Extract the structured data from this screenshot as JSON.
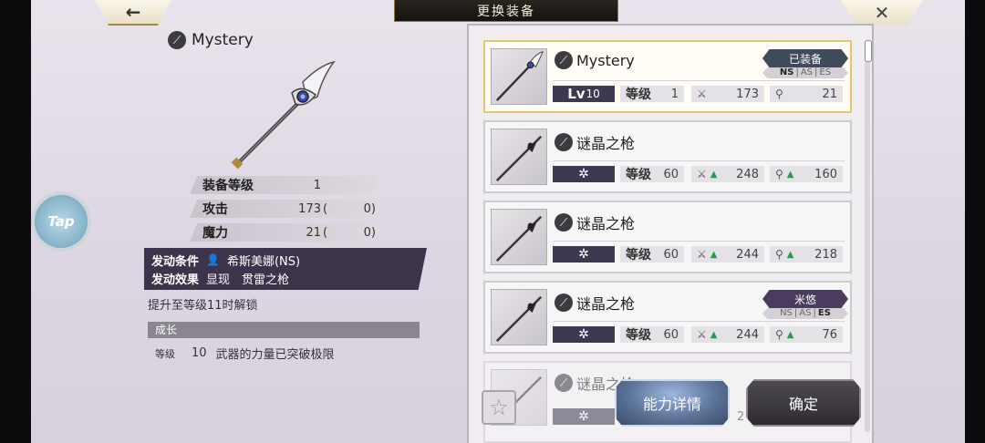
{
  "header": {
    "title": "更换装备",
    "back_icon": "←",
    "close_icon": "✕"
  },
  "detail": {
    "weapon_name": "Mystery",
    "stats": {
      "equip_level_label": "装备等级",
      "equip_level_value": "1",
      "attack_label": "攻击",
      "attack_value": "173",
      "attack_bonus": "0",
      "magic_label": "魔力",
      "magic_value": "21",
      "magic_bonus": "0",
      "paren_open": "(",
      "paren_close": ")"
    },
    "trigger": {
      "condition_label": "发动条件",
      "condition_value": "希斯美娜(NS)",
      "effect_label": "发动效果",
      "effect_value": "显现　贯雷之枪"
    },
    "unlock_text": "提升至等级11时解锁",
    "growth": {
      "title": "成长",
      "level_label": "等级",
      "level_value": "10",
      "description": "武器的力量已突破极限"
    }
  },
  "tap_label": "Tap",
  "list": [
    {
      "name": "Mystery",
      "lv_prefix": "Lv",
      "lv_value": "10",
      "level_label": "等级",
      "level_value": "1",
      "attack": "173",
      "magic": "21",
      "badge": "已装备",
      "badge_tags": [
        "NS",
        "AS",
        "ES"
      ]
    },
    {
      "name": "谜晶之枪",
      "gear": "✲",
      "level_label": "等级",
      "level_value": "60",
      "attack": "248",
      "magic": "160"
    },
    {
      "name": "谜晶之枪",
      "gear": "✲",
      "level_label": "等级",
      "level_value": "60",
      "attack": "244",
      "magic": "218"
    },
    {
      "name": "谜晶之枪",
      "gear": "✲",
      "level_label": "等级",
      "level_value": "60",
      "attack": "244",
      "magic": "76",
      "badge": "米悠",
      "badge_tags": [
        "NS",
        "AS",
        "ES"
      ]
    },
    {
      "name": "谜晶之枪",
      "gear": "✲",
      "level_value": "2"
    }
  ],
  "buttons": {
    "favorite_icon": "☆",
    "detail": "能力详情",
    "confirm": "确定"
  },
  "colors": {
    "selected_border": "#e4c66c",
    "dark_panel": "#3c344a",
    "stat_up": "#2a9a53"
  }
}
